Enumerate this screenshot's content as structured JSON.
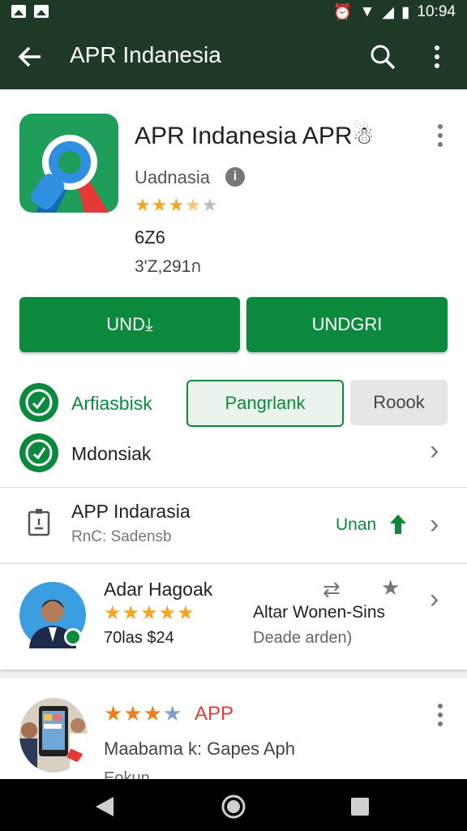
{
  "status_bar": {
    "time": "10:94"
  },
  "app_bar": {
    "title": "APR Indanesia"
  },
  "app": {
    "name": "APR Indanesia APR☃",
    "developer": "Uadnasia",
    "rating_stars": 3,
    "size": "6Ζ6",
    "downloads": "3'Z,291ก"
  },
  "buttons": {
    "install": "UND⤓",
    "update": "UNDGRI"
  },
  "options": {
    "item1": "Arfiasbisk",
    "item2": "Mdonsiak",
    "pill_selected": "Pangrlank",
    "pill_other": "Roook"
  },
  "info_row": {
    "title": "APP Indarasia",
    "subtitle": "RnC: Sadensb",
    "action": "Unan"
  },
  "review": {
    "name": "Adar Hagoak",
    "stars": 5,
    "meta": "70las  $24",
    "headline": "Altar Wonen-Sins",
    "subtext": "Deade arden)"
  },
  "next_app": {
    "badge": "APP",
    "stars": 4,
    "line1": "Maabama k: Gapes Aph",
    "line2": "Eokun"
  },
  "colors": {
    "green": "#0b8a3e",
    "bar": "#1e3a26",
    "star": "#f4a623"
  }
}
